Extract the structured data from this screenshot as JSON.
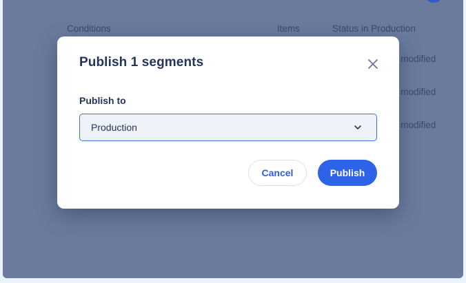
{
  "background_table": {
    "columns": [
      "Conditions",
      "Items",
      "Status in Production"
    ],
    "rows": [
      {
        "status": "d modified"
      },
      {
        "status": "d modified"
      },
      {
        "status": "d modified"
      }
    ]
  },
  "modal": {
    "title": "Publish 1 segments",
    "field_label": "Publish to",
    "select_value": "Production",
    "cancel_label": "Cancel",
    "publish_label": "Publish"
  },
  "icons": {
    "close": "close-icon",
    "dropdown": "chevron-down-icon"
  },
  "colors": {
    "overlay": "#6a7b9e",
    "primary": "#2d63e6",
    "title_text": "#25355a",
    "select_bg": "#eff1f8",
    "select_border": "#3f6fe0"
  }
}
